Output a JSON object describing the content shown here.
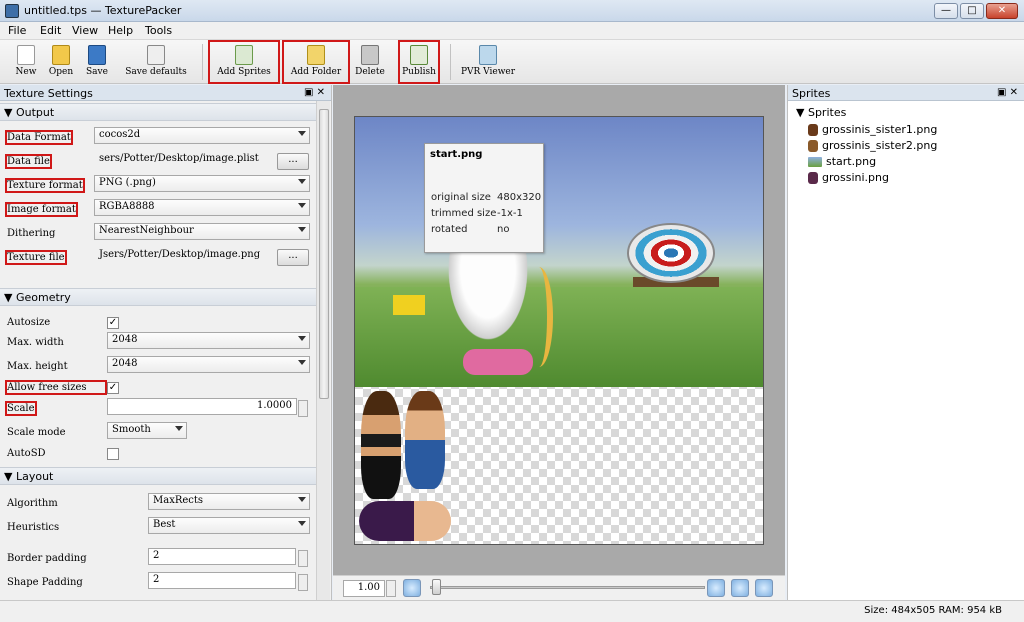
{
  "window": {
    "title": "untitled.tps — TexturePacker",
    "minimize": "—",
    "maximize": "□",
    "close": "✕"
  },
  "menu": [
    "File",
    "Edit",
    "View",
    "Help",
    "Tools"
  ],
  "toolbar": {
    "new": "New",
    "open": "Open",
    "save": "Save",
    "save_defaults": "Save defaults",
    "add_sprites": "Add Sprites",
    "add_folder": "Add Folder",
    "delete": "Delete",
    "publish": "Publish",
    "pvr_viewer": "PVR Viewer"
  },
  "texture_settings": {
    "title": "Texture Settings",
    "output_section": "Output",
    "data_format": {
      "label": "Data Format",
      "value": "cocos2d"
    },
    "data_file": {
      "label": "Data file",
      "value": "sers/Potter/Desktop/image.plist",
      "button": "..."
    },
    "texture_format": {
      "label": "Texture format",
      "value": "PNG (.png)"
    },
    "image_format": {
      "label": "Image format",
      "value": "RGBA8888"
    },
    "dithering": {
      "label": "Dithering",
      "value": "NearestNeighbour"
    },
    "texture_file": {
      "label": "Texture file",
      "value": "Jsers/Potter/Desktop/image.png",
      "button": "..."
    },
    "geometry_section": "Geometry",
    "autosize": {
      "label": "Autosize",
      "checked": true
    },
    "max_width": {
      "label": "Max. width",
      "value": "2048"
    },
    "max_height": {
      "label": "Max. height",
      "value": "2048"
    },
    "allow_free_sizes": {
      "label": "Allow free sizes",
      "checked": true
    },
    "scale": {
      "label": "Scale",
      "value": "1.0000"
    },
    "scale_mode": {
      "label": "Scale mode",
      "value": "Smooth"
    },
    "autosd": {
      "label": "AutoSD",
      "checked": false
    },
    "layout_section": "Layout",
    "algorithm": {
      "label": "Algorithm",
      "value": "MaxRects"
    },
    "heuristics": {
      "label": "Heuristics",
      "value": "Best"
    },
    "border_padding": {
      "label": "Border padding",
      "value": "2"
    },
    "shape_padding": {
      "label": "Shape Padding",
      "value": "2"
    }
  },
  "tooltip": {
    "title": "start.png",
    "original_size_key": "original size",
    "original_size_val": "480x320",
    "trimmed_size_key": "trimmed size",
    "trimmed_size_val": "-1x-1",
    "rotated_key": "rotated",
    "rotated_val": "no"
  },
  "zoom": {
    "value": "1.00"
  },
  "sprites_panel": {
    "title": "Sprites",
    "root": "Sprites",
    "items": [
      "grossinis_sister1.png",
      "grossinis_sister2.png",
      "start.png",
      "grossini.png"
    ]
  },
  "status": {
    "text": "Size: 484x505 RAM: 954 kB"
  },
  "colors": {
    "highlight": "#d01818",
    "selection": "#3399ff"
  }
}
